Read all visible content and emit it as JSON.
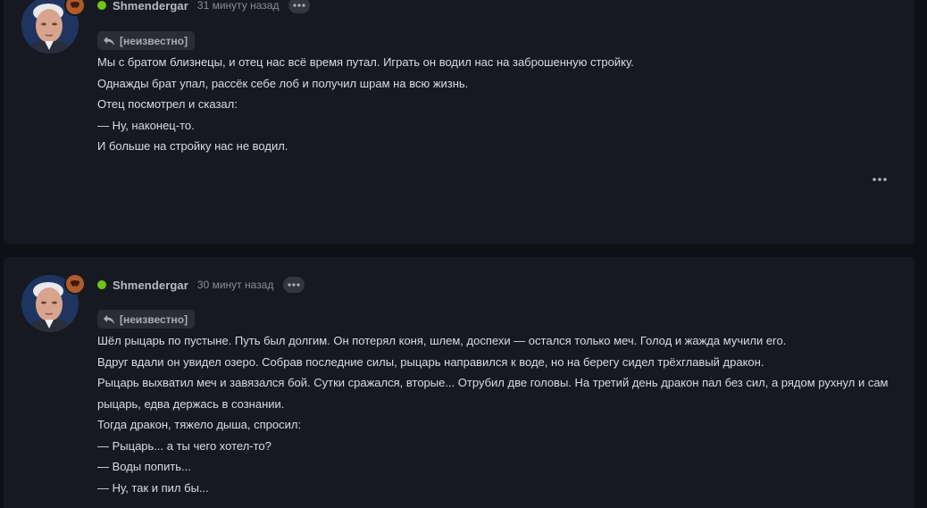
{
  "posts": [
    {
      "author": "Shmendergar",
      "time": "31 минуту назад",
      "reply_label": "[неизвестно]",
      "lines": [
        "Мы с братом близнецы, и отец нас всё время путал. Играть он водил нас на заброшенную стройку.",
        "Однажды брат упал, рассёк себе лоб и получил шрам на всю жизнь.",
        "Отец посмотрел и сказал:",
        "— Ну, наконец-то.",
        "И больше на стройку нас не водил."
      ]
    },
    {
      "author": "Shmendergar",
      "time": "30 минут назад",
      "reply_label": "[неизвестно]",
      "lines": [
        "Шёл рыцарь по пустыне. Путь был долгим. Он потерял коня, шлем, доспехи — остался только меч. Голод и жажда мучили его.",
        "Вдруг вдали он увидел озеро. Собрав последние силы, рыцарь направился к воде, но на берегу сидел трёхглавый дракон.",
        "Рыцарь выхватил меч и завязался бой. Сутки сражался, вторые... Отрубил две головы. На третий день дракон пал без сил, а рядом рухнул и сам рыцарь, едва держась в сознании.",
        "Тогда дракон, тяжело дыша, спросил:",
        "— Рыцарь... а ты чего хотел-то?",
        "— Воды попить...",
        "— Ну, так и пил бы..."
      ]
    }
  ],
  "colors": {
    "online": "#6fc614",
    "badge": "#b15a2a",
    "card": "#171922",
    "page": "#0f1016"
  },
  "icons": [
    "ellipsis-icon",
    "reply-icon",
    "mask-badge-icon",
    "online-indicator"
  ]
}
